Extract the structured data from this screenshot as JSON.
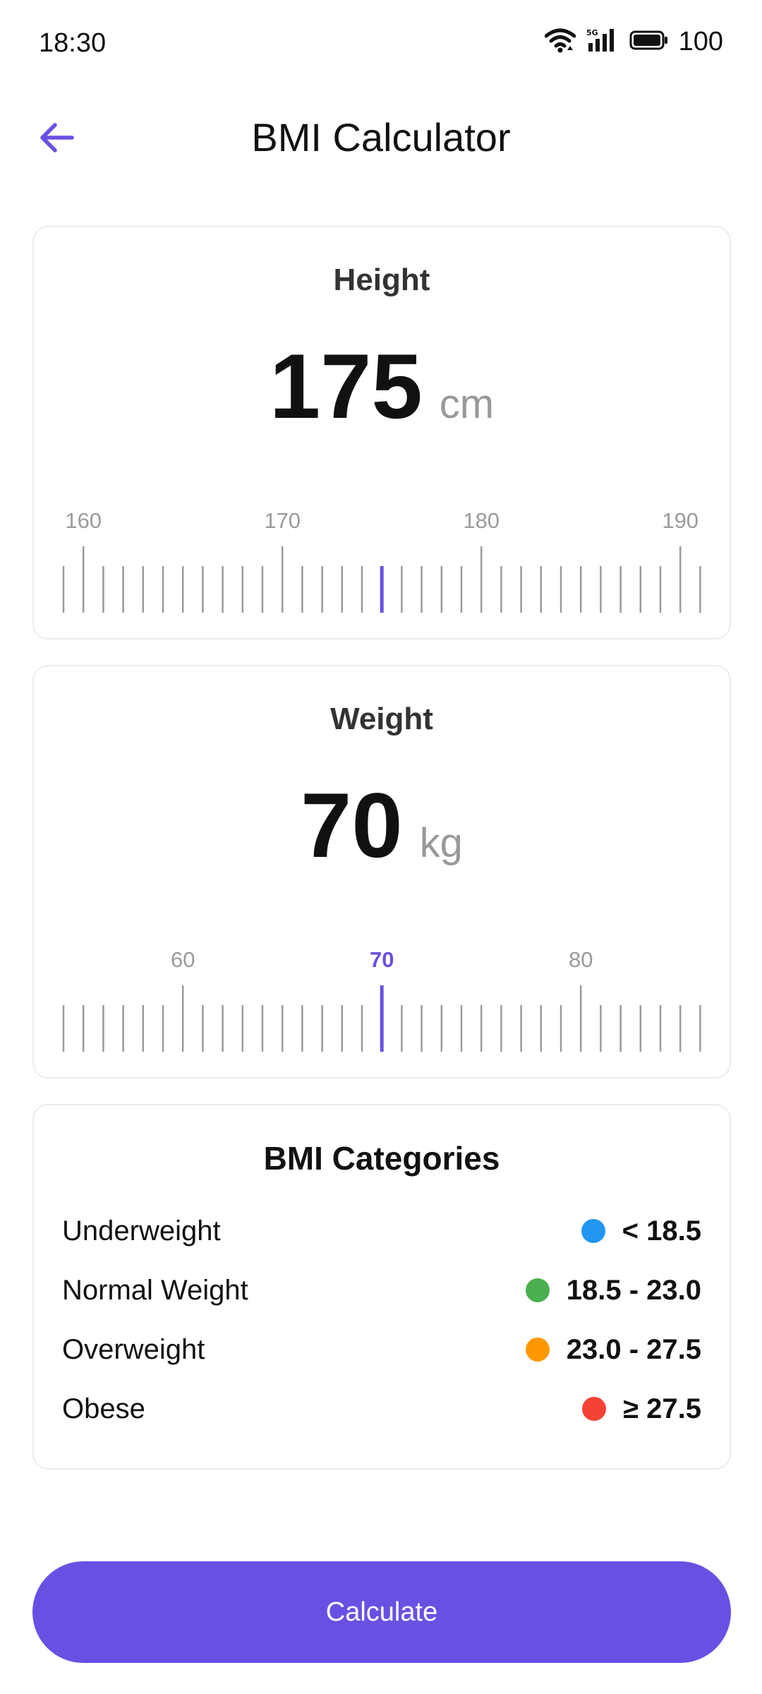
{
  "status_bar": {
    "time": "18:30",
    "battery": "100",
    "network": "5G"
  },
  "app_bar": {
    "title": "BMI Calculator",
    "back_icon": "arrow-left-icon"
  },
  "colors": {
    "accent": "#6a50e2",
    "tick": "#9a9a9a",
    "label": "#9a9a9a"
  },
  "height": {
    "title": "Height",
    "value": "175",
    "unit": "cm",
    "ruler": {
      "min": 159,
      "max": 191,
      "selected": 175,
      "major_every": 10,
      "labels": [
        "160",
        "170",
        "180",
        "190"
      ]
    }
  },
  "weight": {
    "title": "Weight",
    "value": "70",
    "unit": "kg",
    "ruler": {
      "min": 54,
      "max": 86,
      "selected": 70,
      "major_every": 10,
      "labels": [
        "60",
        "70",
        "80"
      ]
    }
  },
  "categories": {
    "title": "BMI Categories",
    "items": [
      {
        "label": "Underweight",
        "range": "< 18.5",
        "color": "#2196f3"
      },
      {
        "label": "Normal Weight",
        "range": "18.5 - 23.0",
        "color": "#4caf50"
      },
      {
        "label": "Overweight",
        "range": "23.0 - 27.5",
        "color": "#ff9800"
      },
      {
        "label": "Obese",
        "range": "≥ 27.5",
        "color": "#f44336"
      }
    ]
  },
  "actions": {
    "calculate_label": "Calculate"
  }
}
